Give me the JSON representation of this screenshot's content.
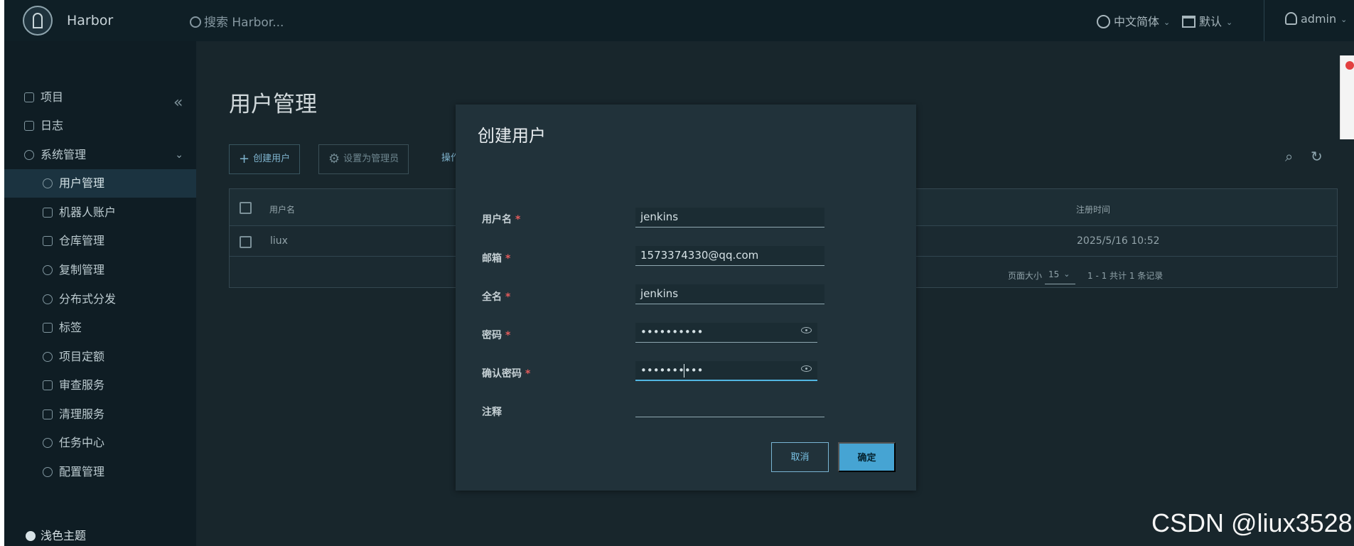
{
  "app": {
    "name": "Harbor",
    "search_placeholder": "搜索 Harbor...",
    "language": "中文简体",
    "default_label": "默认",
    "user": "admin"
  },
  "sidebar": {
    "items": [
      {
        "label": "项目"
      },
      {
        "label": "日志"
      },
      {
        "label": "系统管理"
      },
      {
        "label": "用户管理"
      },
      {
        "label": "机器人账户"
      },
      {
        "label": "仓库管理"
      },
      {
        "label": "复制管理"
      },
      {
        "label": "分布式分发"
      },
      {
        "label": "标签"
      },
      {
        "label": "项目定额"
      },
      {
        "label": "审查服务"
      },
      {
        "label": "清理服务"
      },
      {
        "label": "任务中心"
      },
      {
        "label": "配置管理"
      }
    ],
    "theme_label": "浅色主题"
  },
  "page": {
    "title": "用户管理",
    "create_user_button": "创建用户",
    "set_admin_button": "设置为管理员",
    "actions_button": "操作",
    "table": {
      "headers": [
        "用户名",
        "注册时间"
      ],
      "rows": [
        {
          "username": "liux",
          "created_at": "2025/5/16 10:52"
        }
      ],
      "page_size_label": "页面大小",
      "page_size": "15",
      "total_text": "1 - 1 共计 1 条记录"
    }
  },
  "modal": {
    "title": "创建用户",
    "fields": {
      "username_label": "用户名",
      "username_value": "jenkins",
      "email_label": "邮箱",
      "email_value": "1573374330@qq.com",
      "fullname_label": "全名",
      "fullname_value": "jenkins",
      "password_label": "密码",
      "password_value": "••••••••••",
      "confirm_password_label": "确认密码",
      "confirm_password_value": "••••••••••",
      "comment_label": "注释"
    },
    "cancel_button": "取消",
    "ok_button": "确定"
  },
  "watermark": "CSDN @liux3528",
  "colors": {
    "accent": "#46a4d3",
    "required": "#e25b5b",
    "background": "#18262c"
  }
}
